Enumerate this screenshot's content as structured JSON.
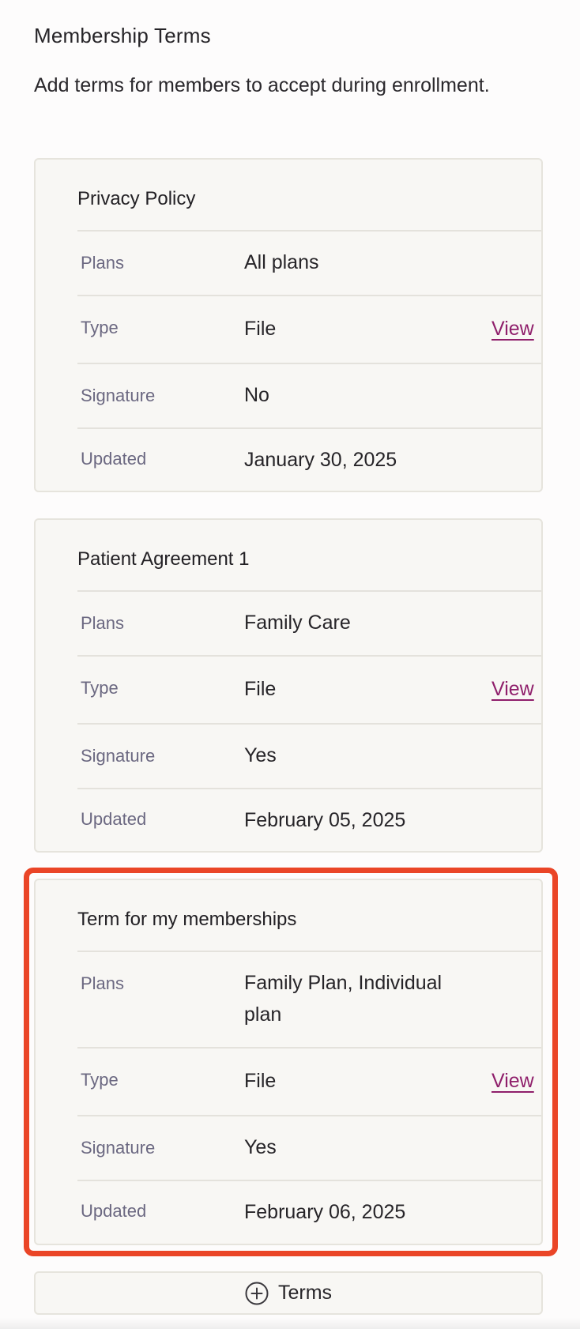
{
  "section": {
    "title": "Membership Terms",
    "description": "Add terms for members to accept during enrollment."
  },
  "labels": {
    "plans": "Plans",
    "type": "Type",
    "signature": "Signature",
    "updated": "Updated",
    "view": "View"
  },
  "terms": [
    {
      "title": "Privacy Policy",
      "plans": "All plans",
      "type": "File",
      "signature": "No",
      "updated": "January 30, 2025"
    },
    {
      "title": "Patient Agreement 1",
      "plans": "Family Care",
      "type": "File",
      "signature": "Yes",
      "updated": "February 05, 2025"
    },
    {
      "title": "Term for my memberships",
      "plans": "Family Plan, Individual plan",
      "type": "File",
      "signature": "Yes",
      "updated": "February 06, 2025"
    }
  ],
  "add_button": {
    "label": "Terms",
    "icon": "plus-circle-icon"
  },
  "highlight_color": "#ea4527",
  "link_color": "#8f1f6b"
}
